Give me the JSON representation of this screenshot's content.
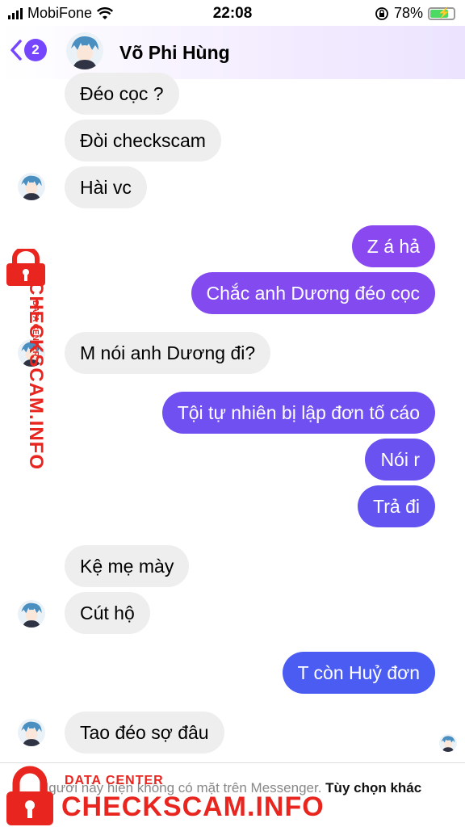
{
  "status_bar": {
    "carrier": "MobiFone",
    "time": "22:08",
    "battery": "78%",
    "battery_level": 0.78
  },
  "header": {
    "back_badge": "2",
    "contact_name": "Võ Phi Hùng"
  },
  "messages": [
    {
      "side": "in",
      "text": "Đéo cọc ?"
    },
    {
      "side": "in",
      "text": "Đòi checkscam"
    },
    {
      "side": "in",
      "text": "Hài vc"
    },
    {
      "side": "out",
      "text": "Z á hả"
    },
    {
      "side": "out",
      "text": "Chắc anh Dương đéo cọc"
    },
    {
      "side": "in",
      "text": "M nói anh Dương đi?"
    },
    {
      "side": "out",
      "text": "Tội tự nhiên bị lập đơn tố cáo"
    },
    {
      "side": "out",
      "text": "Nói r"
    },
    {
      "side": "out",
      "text": "Trả đi"
    },
    {
      "side": "in",
      "text": "Kệ mẹ mày"
    },
    {
      "side": "in",
      "text": "Cút hộ"
    },
    {
      "side": "out",
      "text": "T còn Huỷ đơn"
    },
    {
      "side": "in",
      "text": "Tao đéo sợ đâu"
    }
  ],
  "footer": {
    "notice": "Người này hiện không có mặt trên Messenger.",
    "options": "Tùy chọn khác"
  },
  "watermark": {
    "top_text": "DATA CENTER",
    "brand": "CHECKSCAM.INFO"
  },
  "colors": {
    "accent": "#7646ff",
    "outgoing_top": "#8a48f0",
    "outgoing_bottom": "#4a5cf2",
    "incoming": "#eeeeef",
    "watermark": "#e8251f"
  }
}
